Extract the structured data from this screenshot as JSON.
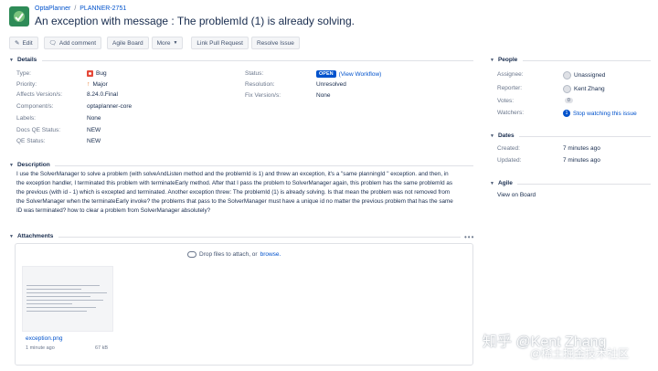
{
  "header": {
    "breadcrumb": [
      "OptaPlanner",
      "PLANNER-2751"
    ],
    "title": "An exception with message : The problemId (1) is already solving."
  },
  "toolbar": {
    "edit": "Edit",
    "add_comment": "Add comment",
    "agile_board": "Agile Board",
    "more": "More",
    "link_pull_request": "Link Pull Request",
    "resolve_issue": "Resolve Issue"
  },
  "details": {
    "heading": "Details",
    "type_label": "Type:",
    "type_value": "Bug",
    "priority_label": "Priority:",
    "priority_value": "Major",
    "affects_label": "Affects Version/s:",
    "affects_value": "8.24.0.Final",
    "components_label": "Component/s:",
    "components_value": "optaplanner-core",
    "labels_label": "Labels:",
    "labels_value": "None",
    "docs_qe_label": "Docs QE Status:",
    "docs_qe_value": "NEW",
    "qe_label": "QE Status:",
    "qe_value": "NEW",
    "status_label": "Status:",
    "status_value": "OPEN",
    "view_workflow": "(View Workflow)",
    "resolution_label": "Resolution:",
    "resolution_value": "Unresolved",
    "fix_label": "Fix Version/s:",
    "fix_value": "None"
  },
  "description": {
    "heading": "Description",
    "text": "I use the SolverManager to solve a problem (with solveAndListen method and the problemId is 1) and threw an exception, it's a \"same planningId \" exception. and then, in the exception handler, I terminated this problem with terminateEarly method. After that I pass the problem to SolverManager again, this problem has the same problemId as the previous (with id - 1) which is excepted and terminated. Another exception threw: The problemId (1) is already solving. Is that mean the problem was not removed from the SolverManager when the terminateEarly invoke? the problems that pass to the SolverManager must have a unique id no matter the previous problem that has the same ID was terminated? how to clear a problem from SolverManager absolutely?"
  },
  "attachments": {
    "heading": "Attachments",
    "more": "•••",
    "drop_text": "Drop files to attach, or",
    "browse": "browse.",
    "file_name": "exception.png",
    "file_time": "1 minute ago",
    "file_size": "67 kB"
  },
  "people": {
    "heading": "People",
    "assignee_label": "Assignee:",
    "assignee_value": "Unassigned",
    "reporter_label": "Reporter:",
    "reporter_value": "Kent Zhang",
    "votes_label": "Votes:",
    "votes_value": "0",
    "watchers_label": "Watchers:",
    "watchers_count": "1",
    "watchers_action": "Stop watching this issue"
  },
  "dates": {
    "heading": "Dates",
    "created_label": "Created:",
    "created_value": "7 minutes ago",
    "updated_label": "Updated:",
    "updated_value": "7 minutes ago"
  },
  "agile": {
    "heading": "Agile",
    "link": "View on Board"
  },
  "watermark": {
    "line1": "知乎 @Kent Zhang",
    "line2": "@稀土掘金技术社区"
  }
}
